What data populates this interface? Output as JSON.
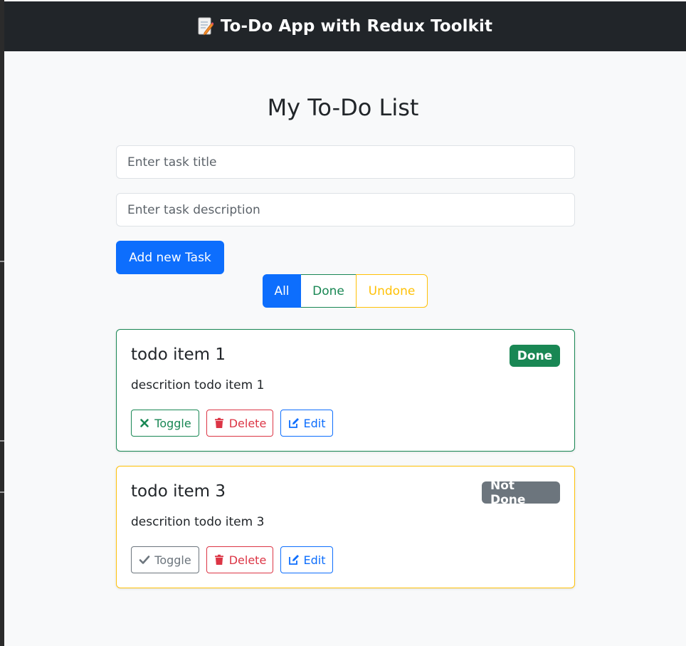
{
  "header": {
    "title": "To-Do App with Redux Toolkit",
    "icon": "memo-icon"
  },
  "main": {
    "heading": "My To-Do List",
    "title_input": {
      "placeholder": "Enter task title",
      "value": ""
    },
    "description_input": {
      "placeholder": "Enter task description",
      "value": ""
    },
    "add_button_label": "Add new Task",
    "filters": {
      "all": "All",
      "done": "Done",
      "undone": "Undone",
      "active": "All"
    }
  },
  "todos": [
    {
      "title": "todo item 1",
      "description": "descrition todo item 1",
      "status_label": "Done",
      "status": "done",
      "actions": {
        "toggle": "Toggle",
        "delete": "Delete",
        "edit": "Edit"
      }
    },
    {
      "title": "todo item 3",
      "description": "descrition todo item 3",
      "status_label": "Not Done",
      "status": "undone",
      "actions": {
        "toggle": "Toggle",
        "delete": "Delete",
        "edit": "Edit"
      }
    }
  ],
  "colors": {
    "header_bg": "#212529",
    "primary": "#0d6efd",
    "success": "#198754",
    "warning": "#ffc107",
    "danger": "#dc3545",
    "secondary": "#6c757d"
  }
}
